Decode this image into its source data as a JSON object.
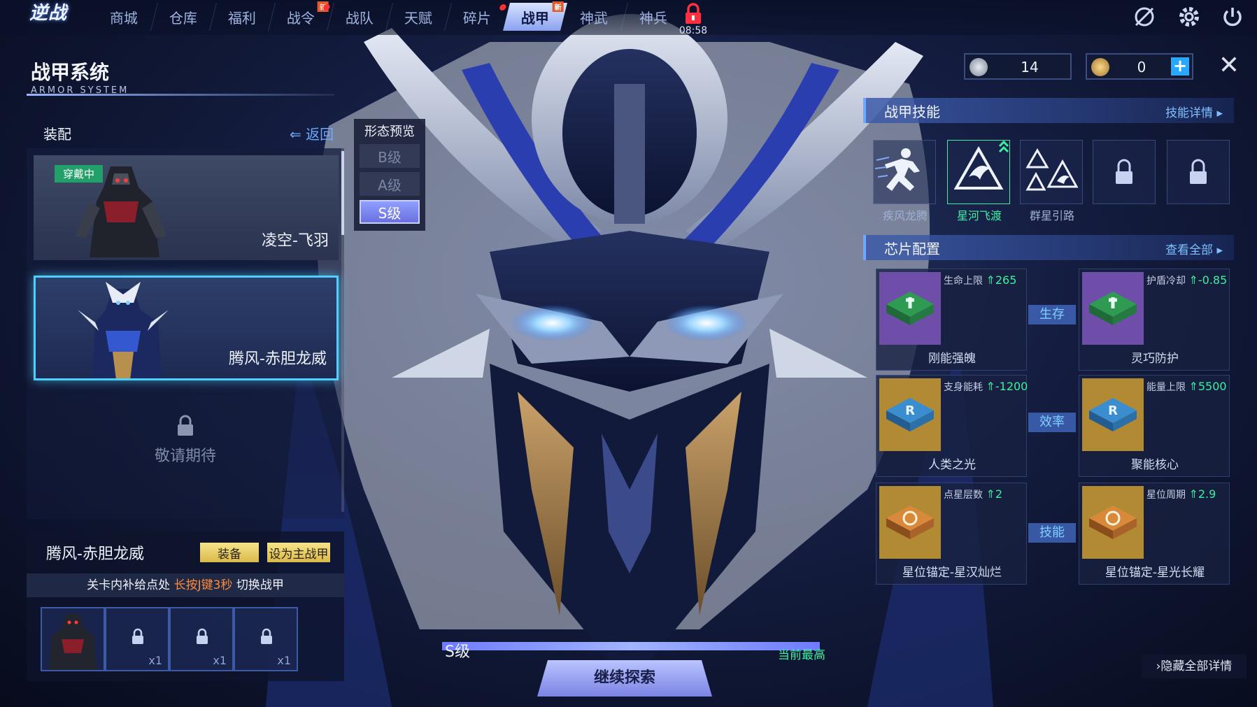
{
  "logo": {
    "text": "逆战"
  },
  "nav": {
    "tabs": [
      {
        "label": "商城"
      },
      {
        "label": "仓库"
      },
      {
        "label": "福利"
      },
      {
        "label": "战令",
        "badge": "新"
      },
      {
        "label": "战队"
      },
      {
        "label": "天赋"
      },
      {
        "label": "碎片"
      },
      {
        "label": "战甲",
        "badge": "新"
      },
      {
        "label": "神武"
      },
      {
        "label": "神兵"
      }
    ],
    "timer": "08:58",
    "icons": [
      "no-signal-icon",
      "gear-icon",
      "power-icon"
    ]
  },
  "header": {
    "title": "战甲系统",
    "subtitle": "ARMOR SYSTEM"
  },
  "left": {
    "equip_label": "装配",
    "back_label": "返回",
    "armors": [
      {
        "name": "凌空-飞羽",
        "status": "穿戴中"
      },
      {
        "name": "腾风-赤胆龙威"
      }
    ],
    "coming_soon": "敬请期待",
    "current_armor": "腾风-赤胆龙威",
    "equip_btn": "装备",
    "set_main_btn": "设为主战甲",
    "hint_pre": "关卡内补给点处",
    "hint_key": "长按J键3秒",
    "hint_post": "切换战甲",
    "slots": [
      {
        "type": "armor"
      },
      {
        "type": "locked",
        "qty": "x1"
      },
      {
        "type": "locked",
        "qty": "x1"
      },
      {
        "type": "locked",
        "qty": "x1"
      }
    ]
  },
  "form_preview": {
    "title": "形态预览",
    "grades": [
      "B级",
      "A级",
      "S级"
    ],
    "selected": "S级"
  },
  "currency": {
    "silver": "14",
    "gold": "0"
  },
  "skills": {
    "title": "战甲技能",
    "detail_link": "技能详情",
    "items": [
      {
        "name": "疾风龙腾",
        "icon": "running-figure-icon"
      },
      {
        "name": "星河飞渡",
        "icon": "dragon-emblem-icon"
      },
      {
        "name": "群星引路",
        "icon": "triple-dragon-icon"
      },
      {
        "name": "",
        "icon": "lock-icon"
      },
      {
        "name": "",
        "icon": "lock-icon"
      }
    ]
  },
  "chips": {
    "title": "芯片配置",
    "view_all": "查看全部",
    "categories": [
      "生存",
      "效率",
      "技能"
    ],
    "items": [
      {
        "name": "刚能强魄",
        "stat": "生命上限",
        "value": "265"
      },
      {
        "name": "灵巧防护",
        "stat": "护盾冷却",
        "value": "-0.85"
      },
      {
        "name": "人类之光",
        "stat": "支身能耗",
        "value": "-1200"
      },
      {
        "name": "聚能核心",
        "stat": "能量上限",
        "value": "5500"
      },
      {
        "name": "星位锚定-星汉灿烂",
        "stat": "点星层数",
        "value": "2"
      },
      {
        "name": "星位锚定-星光长耀",
        "stat": "星位周期",
        "value": "2.9"
      }
    ]
  },
  "bottom": {
    "grade": "S级",
    "max_label": "当前最高",
    "explore_btn": "继续探索",
    "hide_all": "隐藏全部详情"
  },
  "colors": {
    "accent": "#4ed0ff",
    "highlight_green": "#3cf0a0",
    "warn_orange": "#ff8a3c",
    "button_yellow": "#f7e48a"
  }
}
